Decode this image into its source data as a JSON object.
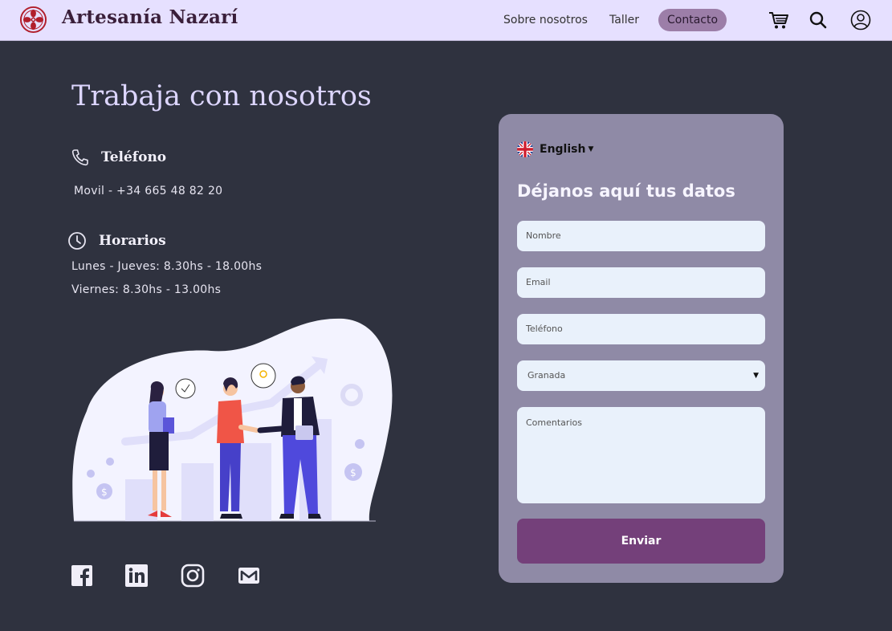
{
  "header": {
    "brand": "Artesanía Nazarí",
    "nav": [
      {
        "label": "Sobre nosotros"
      },
      {
        "label": "Taller"
      },
      {
        "label": "Contacto",
        "active": true
      }
    ],
    "icons": [
      "cart-icon",
      "search-icon",
      "user-icon"
    ]
  },
  "page": {
    "title": "Trabaja con nosotros",
    "phone": {
      "heading": "Teléfono",
      "text": "Movil - +34 665 48 82 20"
    },
    "hours": {
      "heading": "Horarios",
      "lines": [
        "Lunes - Jueves: 8.30hs - 18.00hs",
        "Viernes: 8.30hs - 13.00hs"
      ]
    },
    "social": [
      "facebook-icon",
      "linkedin-icon",
      "instagram-icon",
      "mail-icon"
    ]
  },
  "form": {
    "language": "English",
    "title": "Déjanos aquí tus datos",
    "fields": {
      "name_placeholder": "Nombre",
      "email_placeholder": "Email",
      "phone_placeholder": "Teléfono",
      "city_value": "Granada",
      "comments_placeholder": "Comentarios"
    },
    "submit_label": "Enviar"
  },
  "colors": {
    "header_bg": "#e6e0ff",
    "page_bg": "#2f323f",
    "title": "#ddd6ff",
    "card_bg": "#8f8aa6",
    "field_bg": "#e9f1fb",
    "button": "#74407a",
    "nav_active": "#9c7ea8",
    "logo": "#b11e2b"
  }
}
